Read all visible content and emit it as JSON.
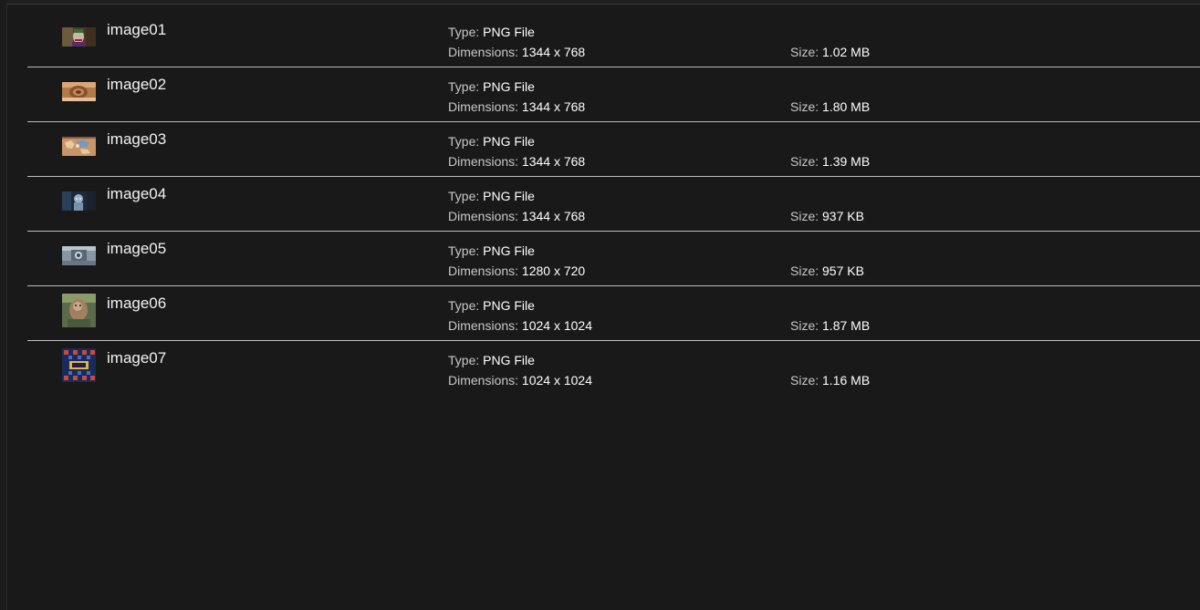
{
  "files": [
    {
      "name": "image01",
      "type_label": "Type:",
      "type_value": "PNG File",
      "dims_label": "Dimensions:",
      "dims_value": "1344 x 768",
      "size_label": "Size:",
      "size_value": "1.02 MB",
      "thumb_icon": "joker-portrait-thumbnail"
    },
    {
      "name": "image02",
      "type_label": "Type:",
      "type_value": "PNG File",
      "dims_label": "Dimensions:",
      "dims_value": "1344 x 768",
      "size_label": "Size:",
      "size_value": "1.80 MB",
      "thumb_icon": "spiral-shell-thumbnail"
    },
    {
      "name": "image03",
      "type_label": "Type:",
      "type_value": "PNG File",
      "dims_label": "Dimensions:",
      "dims_value": "1344 x 768",
      "size_label": "Size:",
      "size_value": "1.39 MB",
      "thumb_icon": "map-thumbnail"
    },
    {
      "name": "image04",
      "type_label": "Type:",
      "type_value": "PNG File",
      "dims_label": "Dimensions:",
      "dims_value": "1344 x 768",
      "size_label": "Size:",
      "size_value": "937 KB",
      "thumb_icon": "robot-thumbnail"
    },
    {
      "name": "image05",
      "type_label": "Type:",
      "type_value": "PNG File",
      "dims_label": "Dimensions:",
      "dims_value": "1280 x 720",
      "size_label": "Size:",
      "size_value": "957 KB",
      "thumb_icon": "machine-thumbnail"
    },
    {
      "name": "image06",
      "type_label": "Type:",
      "type_value": "PNG File",
      "dims_label": "Dimensions:",
      "dims_value": "1024 x 1024",
      "size_label": "Size:",
      "size_value": "1.87 MB",
      "thumb_icon": "creature-thumbnail"
    },
    {
      "name": "image07",
      "type_label": "Type:",
      "type_value": "PNG File",
      "dims_label": "Dimensions:",
      "dims_value": "1024 x 1024",
      "size_label": "Size:",
      "size_value": "1.16 MB",
      "thumb_icon": "pattern-thumbnail"
    }
  ],
  "colors": {
    "background": "#191919",
    "divider": "#bdbdbd",
    "text_primary": "#f2f2f2",
    "text_label": "#c8c8c8"
  }
}
